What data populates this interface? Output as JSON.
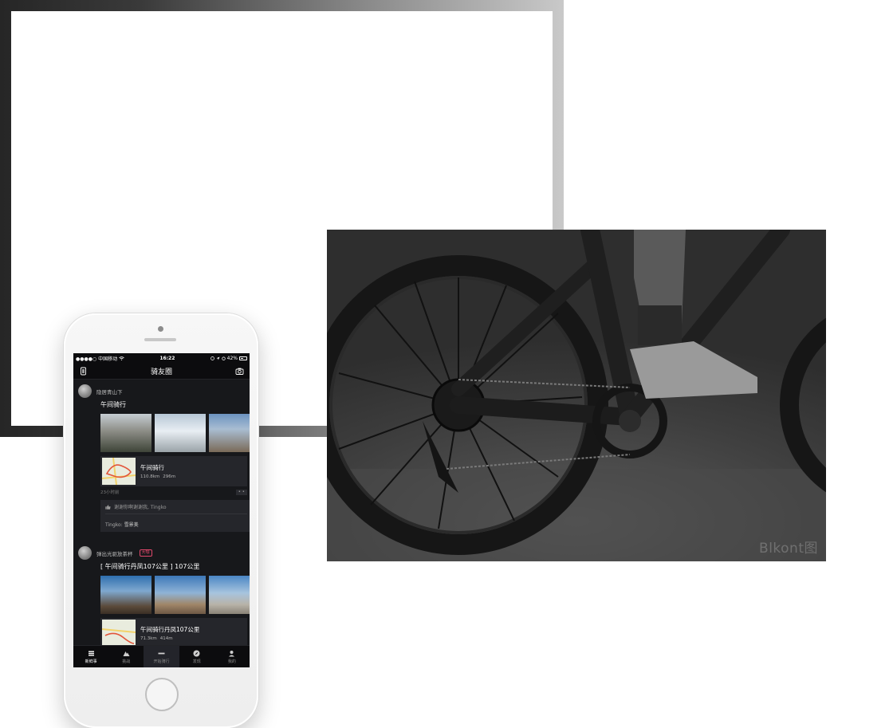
{
  "phone": {
    "status_bar": {
      "carrier": "●●●●○ 中国移动",
      "time": "16:22",
      "battery": "42%"
    },
    "header": {
      "title": "骑友圈",
      "left_icon": "wristwatch-icon",
      "right_icon": "camera-icon"
    },
    "feed": [
      {
        "username": "隐居青山下",
        "badge": "",
        "title": "午间骑行",
        "ride": {
          "title": "午间骑行",
          "distance": "110.8km",
          "elevation": "296m"
        },
        "time_ago": "23小时前",
        "more": "• •",
        "likes": "谢谢你啊谢谢我, Tingko",
        "comment_author": "Tingko:",
        "comment_text": "雪景美"
      },
      {
        "username": "弹出光驱放茶杯",
        "badge": "大咖",
        "title": "[ 午间骑行丹凤107公里 ] 107公里",
        "ride": {
          "title": "午间骑行丹凤107公里",
          "distance": "71.3km",
          "elevation": "414m"
        }
      }
    ],
    "tabs": [
      {
        "label": "新鲜事",
        "icon": "list-icon",
        "active": true
      },
      {
        "label": "挑战",
        "icon": "mountain-icon",
        "active": false
      },
      {
        "label": "开始骑行",
        "icon": "minus-icon",
        "active": false
      },
      {
        "label": "发现",
        "icon": "compass-icon",
        "active": false
      },
      {
        "label": "我的",
        "icon": "user-icon",
        "active": false
      }
    ]
  },
  "photo": {
    "watermark": "Blkont图"
  }
}
